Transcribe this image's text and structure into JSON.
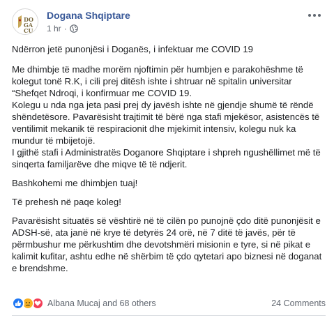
{
  "post": {
    "page_name": "Dogana Shqiptare",
    "time": "1 hr",
    "separator": "·",
    "avatar_icon": "dogana-logo-icon",
    "privacy_icon": "globe-icon",
    "more_icon": "more-options-icon"
  },
  "content": {
    "title": "Ndërron jetë punonjësi i Doganës, i infektuar me COVID 19",
    "p1": "Me dhimbje të madhe morëm njoftimin për humbjen e parakohëshme të kolegut tonë R.K, i cili prej ditësh ishte i shtruar në spitalin universitar “Shefqet Ndroqi, i konfirmuar me COVID 19.\nKolegu u nda nga jeta pasi prej dy javësh ishte në gjendje shumë të rëndë shëndetësore. Pavarësisht trajtimit të bërë nga stafi mjekësor, asistencës të ventilimit mekanik të respiracionit dhe mjekimit intensiv, kolegu nuk ka mundur të mbijetojë.\nI gjithë stafi i Administratës Doganore Shqiptare i shpreh ngushëllimet më të sinqerta familjarëve dhe miqve të të ndjerit.",
    "p2": "Bashkohemi me dhimbjen tuaj!",
    "p3": "Të prehesh në paqe koleg!",
    "p4": "Pavarësisht situatës së vështirë në të cilën po punojnë çdo ditë punonjësit e ADSH-së, ata janë në krye të detyrës 24 orë, në 7 ditë të javës, për të përmbushur me përkushtim dhe devotshmëri misionin e tyre, si në pikat e kalimit kufitar, ashtu edhe në shërbim të çdo qytetari apo biznesi në doganat e brendshme."
  },
  "footer": {
    "reactions_text": "Albana Mucaj and 68 others",
    "comments_text": "24 Comments",
    "reaction_icons": [
      "like-icon",
      "sad-icon",
      "love-icon"
    ],
    "colors": {
      "like": "#2078f4",
      "sad": "#f7b125",
      "love": "#f33e58",
      "link": "#385898"
    }
  }
}
